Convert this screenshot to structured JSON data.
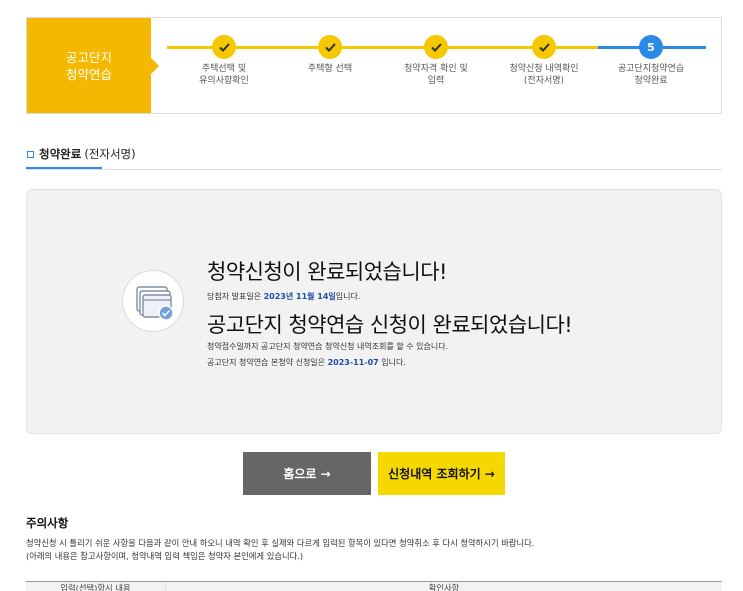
{
  "stepper": {
    "label": "공고단지\n청약연습",
    "steps": [
      {
        "number": "",
        "status": "done",
        "label": "주택선택 및\n유의사항확인"
      },
      {
        "number": "",
        "status": "done",
        "label": "주택형 선택"
      },
      {
        "number": "",
        "status": "done",
        "label": "청약자격 확인 및\n입력"
      },
      {
        "number": "",
        "status": "done",
        "label": "청약신청 내역확인\n(전자서명)"
      },
      {
        "number": "5",
        "status": "active",
        "label": "공고단지청약연습\n청약완료"
      }
    ]
  },
  "section": {
    "title": "청약완료",
    "subtitle": "(전자서명)"
  },
  "completion": {
    "headline": "청약신청이 완료되었습니다!",
    "announce_prefix": "당첨자 발표일은 ",
    "announce_date": "2023년 11월 14일",
    "announce_suffix": "입니다.",
    "headline2": "공고단지 청약연습 신청이 완료되었습니다!",
    "line2": "청약접수일까지 공고단지 청약연습 청약신청 내역조회를 할 수 있습니다.",
    "line3_prefix": "공고단지 청약연습 본청약 신청일은 ",
    "line3_date": "2023-11-07",
    "line3_suffix": " 입니다."
  },
  "buttons": {
    "home": "홈으로 →",
    "check": "신청내역 조회하기 →"
  },
  "notice": {
    "title": "주의사항",
    "line1": "청약신청 시 틀리기 쉬운 사항을 다음과 같이 안내 하오니 내역 확인 후 실제와 다르게 입력된 항목이 있다면 청약취소 후 다시 청약하시기 바랍니다.",
    "line2": "(아래의 내용은 참고사항이며, 청약내역 입력 책임은 청약자 본인에게 있습니다.)",
    "table_headers": [
      "입력(선택)항시 내용",
      "확인사항"
    ]
  },
  "colors": {
    "accent_yellow": "#f5b800",
    "accent_blue": "#2b8ae6",
    "date_blue": "#1b4fa8",
    "home_button": "#666666",
    "check_button": "#f5d800"
  }
}
